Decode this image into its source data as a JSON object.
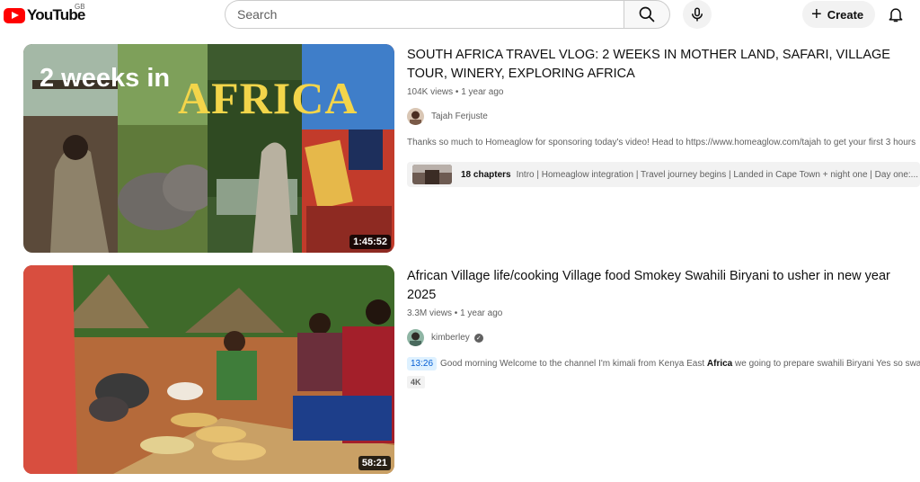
{
  "header": {
    "logo_text": "YouTube",
    "country_code": "GB",
    "search_placeholder": "Search",
    "create_label": "Create",
    "brand_color": "#ff0000"
  },
  "results": [
    {
      "title": "SOUTH AFRICA TRAVEL VLOG: 2 WEEKS IN MOTHER LAND, SAFARI, VILLAGE TOUR, WINERY, EXPLORING AFRICA",
      "views": "104K views",
      "age": "1 year ago",
      "channel": "Tajah Ferjuste",
      "description": "Thanks so much to Homeaglow for sponsoring today's video! Head to https://www.homeaglow.com/tajah to get your first 3 hours",
      "duration": "1:45:52",
      "thumbnail_text_1": "2 weeks in",
      "thumbnail_text_2": "AFRICA",
      "chapters_count": "18 chapters",
      "chapters_text": "Intro | Homeaglow integration | Travel journey begins | Landed in Cape Town + night one | Day one:..."
    },
    {
      "title": "African Village life/cooking Village food Smokey Swahili Biryani to usher in new year 2025",
      "views": "3.3M views",
      "age": "1 year ago",
      "channel": "kimberley",
      "timestamp": "13:26",
      "description_before": "Good morning Welcome to the channel I'm kimali from Kenya East ",
      "description_bold": "Africa",
      "description_after": " we going to prepare swahili Biryani Yes so swah",
      "badge": "4K",
      "duration": "58:21"
    }
  ]
}
